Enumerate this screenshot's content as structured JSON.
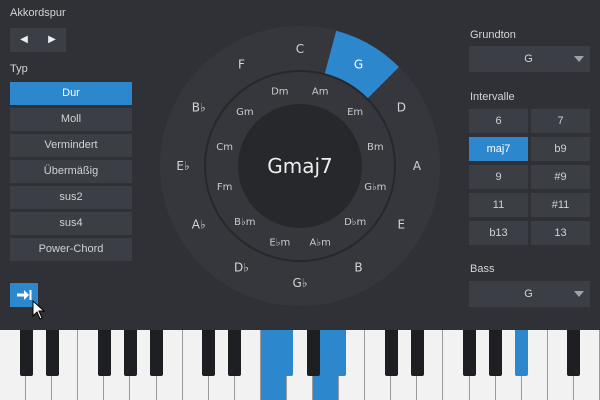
{
  "chord_track": {
    "title": "Akkordspur",
    "prev_icon": "triangle-left",
    "next_icon": "triangle-right"
  },
  "type_panel": {
    "label": "Typ",
    "options": [
      "Dur",
      "Moll",
      "Vermindert",
      "Übermäßig",
      "sus2",
      "sus4",
      "Power-Chord"
    ],
    "selected": "Dur"
  },
  "wheel": {
    "center_label": "Gmaj7",
    "outer_ring": [
      "C",
      "G",
      "D",
      "A",
      "E",
      "B",
      "G♭",
      "D♭",
      "A♭",
      "E♭",
      "B♭",
      "F"
    ],
    "inner_ring": [
      "Am",
      "Em",
      "Bm",
      "G♭m",
      "D♭m",
      "A♭m",
      "E♭m",
      "B♭m",
      "Fm",
      "Cm",
      "Gm",
      "Dm"
    ],
    "selected_outer": "G"
  },
  "root": {
    "label": "Grundton",
    "value": "G"
  },
  "intervals": {
    "label": "Intervalle",
    "options": [
      "6",
      "7",
      "maj7",
      "b9",
      "9",
      "#9",
      "11",
      "#11",
      "b13",
      "13"
    ],
    "selected": "maj7"
  },
  "bass": {
    "label": "Bass",
    "value": "G"
  },
  "insert_button": {
    "icon": "insert-arrow-icon"
  },
  "keyboard": {
    "lit_white_keys": [
      10,
      12
    ],
    "lit_black_keys": [
      7,
      9,
      14
    ]
  },
  "colors": {
    "accent": "#2d87cc",
    "background": "#2f3136",
    "control": "#3b3e44",
    "wheel_outer": "#35373c",
    "wheel_inner": "#26282b"
  }
}
